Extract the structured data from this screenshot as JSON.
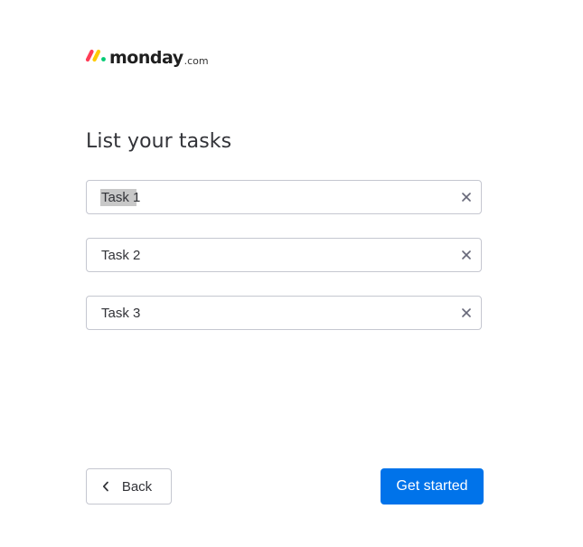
{
  "brand": {
    "name": "monday",
    "suffix": ".com",
    "mark_colors": [
      "#ff3d57",
      "#ffcb00",
      "#00ca72"
    ]
  },
  "page_title": "List your tasks",
  "tasks": [
    {
      "value": "Task 1",
      "selected": true
    },
    {
      "value": "Task 2",
      "selected": false
    },
    {
      "value": "Task 3",
      "selected": false
    }
  ],
  "clear_glyph": "×",
  "buttons": {
    "back_label": "Back",
    "primary_label": "Get started"
  },
  "colors": {
    "primary": "#0073ea",
    "border": "#c5c7d0",
    "text": "#323338"
  }
}
